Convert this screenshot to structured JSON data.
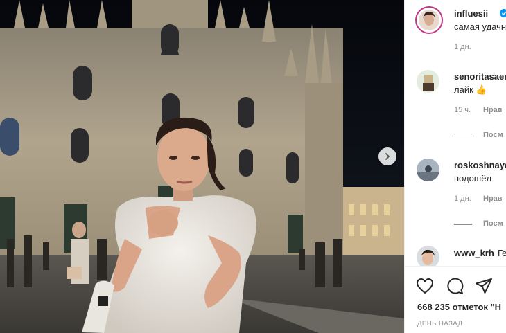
{
  "post": {
    "author": "influesii",
    "caption": "самая удачн",
    "time": "1 дн."
  },
  "comments": [
    {
      "username": "senoritasaen",
      "text": "лайк 👍",
      "time": "15 ч.",
      "like_label": "Нрав",
      "view_replies": "Посм"
    },
    {
      "username": "roskoshnaya",
      "text": "подошёл",
      "time": "1 дн.",
      "like_label": "Нрав",
      "view_replies": "Посм"
    },
    {
      "username": "www_krh",
      "text": "Ге"
    }
  ],
  "actions": {
    "likes": "668 235 отметок \"Н",
    "date": "ДЕНЬ НАЗАД"
  },
  "colors": {
    "verified": "#0095f6",
    "text": "#262626",
    "muted": "#8e8e8e"
  }
}
